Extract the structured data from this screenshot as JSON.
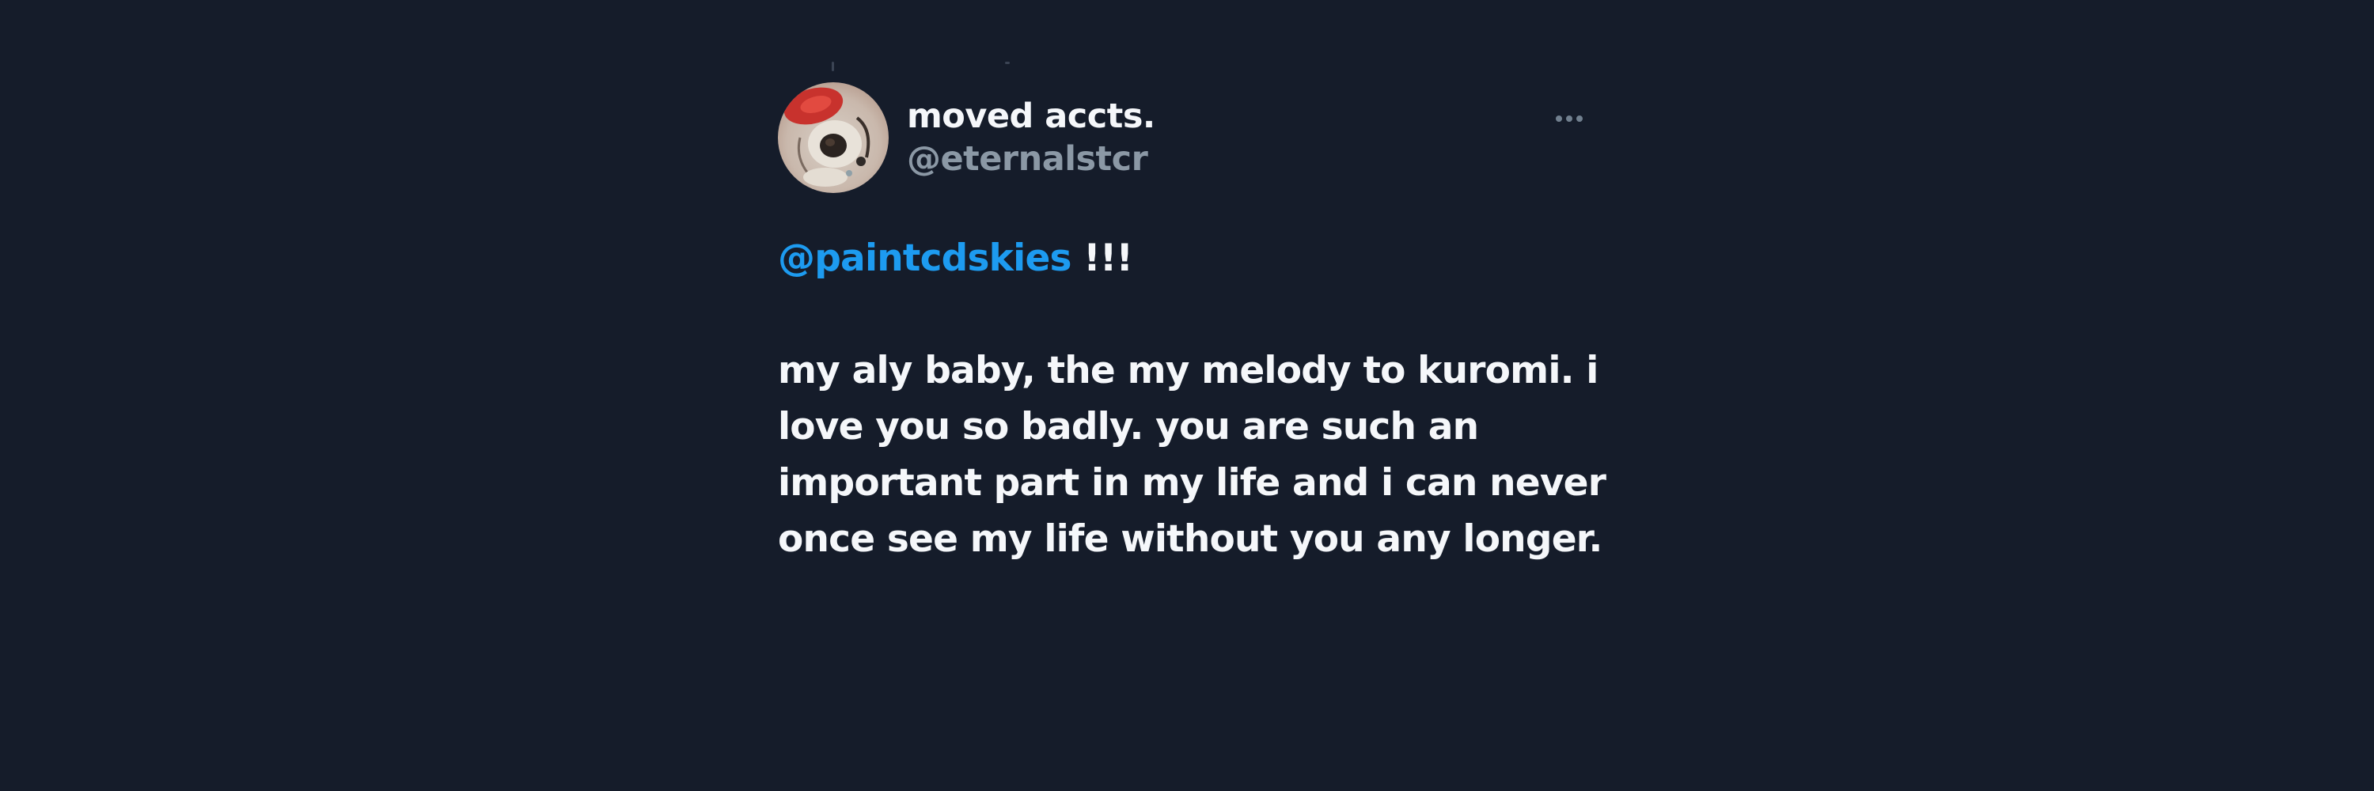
{
  "tweet": {
    "author": {
      "display_name": "moved accts.",
      "handle": "@eternalstcr"
    },
    "more_icon": "more-horizontal-icon",
    "reply_to": {
      "mention": "@paintcdskies",
      "suffix": " !!!"
    },
    "message_lines": [
      "my aly baby, the my melody to kuromi. i",
      "love you so badly. you are such an",
      "important part in my life and i can never",
      "once see my life without you any longer."
    ]
  },
  "colors": {
    "background": "#151c2a",
    "text_primary": "#f5f7fa",
    "text_secondary": "#8b98a5",
    "mention": "#1d9bf0"
  }
}
